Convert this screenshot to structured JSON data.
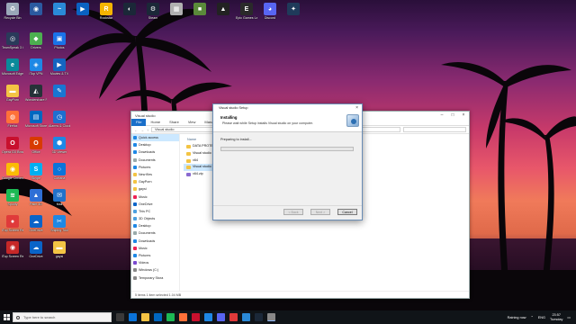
{
  "desktop": {
    "icons": [
      {
        "label": "Recycle Bin",
        "color": "#9aa8b8",
        "glyph": "♻"
      },
      {
        "label": "",
        "color": "#2b5aa0",
        "glyph": "◉"
      },
      {
        "label": "",
        "color": "#2a8ad8",
        "glyph": "~"
      },
      {
        "label": "",
        "color": "#0a62c2",
        "glyph": "▶"
      },
      {
        "label": "Rockstar",
        "color": "#f4b400",
        "glyph": "R"
      },
      {
        "label": "",
        "color": "#1b2838",
        "glyph": "◐"
      },
      {
        "label": "Steam",
        "color": "#1b2838",
        "glyph": "⚙"
      },
      {
        "label": "",
        "color": "#b0b0b0",
        "glyph": "▦"
      },
      {
        "label": "",
        "color": "#5a8a3a",
        "glyph": "■"
      },
      {
        "label": "",
        "color": "#222",
        "glyph": "▲"
      },
      {
        "label": "Epic Games Launcher",
        "color": "#2a2a2a",
        "glyph": "E"
      },
      {
        "label": "Discord",
        "color": "#5865f2",
        "glyph": "◕"
      },
      {
        "label": "",
        "color": "#1f3a5a",
        "glyph": "✦"
      },
      {
        "label": "TeamSpeak 3 Client",
        "color": "#2a3a5a",
        "glyph": "◎"
      },
      {
        "label": "Drivers",
        "color": "#4caf50",
        "glyph": "◆"
      },
      {
        "label": "Photos",
        "color": "#1a73e8",
        "glyph": "▣"
      },
      {
        "label": "Microsoft Edge",
        "color": "#0a8a9a",
        "glyph": "e"
      },
      {
        "label": "iTop VPN",
        "color": "#1e88e5",
        "glyph": "◈"
      },
      {
        "label": "Movies & TV",
        "color": "#1565c0",
        "glyph": "▶"
      },
      {
        "label": "GayPorn",
        "color": "#f3c444",
        "glyph": "▬"
      },
      {
        "label": "Wondershare Filmora 11",
        "color": "#263238",
        "glyph": "◭"
      },
      {
        "label": "",
        "color": "#1976d2",
        "glyph": "✎"
      },
      {
        "label": "Firefox",
        "color": "#ff7139",
        "glyph": "◍"
      },
      {
        "label": "Microsoft Store",
        "color": "#0067c0",
        "glyph": "▤"
      },
      {
        "label": "Alarms & Clock",
        "color": "#1e6fd0",
        "glyph": "◷"
      },
      {
        "label": "Opera GX Browser",
        "color": "#c8102e",
        "glyph": "O"
      },
      {
        "label": "Office",
        "color": "#d83b01",
        "glyph": "O"
      },
      {
        "label": "3D Viewer",
        "color": "#1e88e5",
        "glyph": "⬢"
      },
      {
        "label": "Google Chrome",
        "color": "#fbbc05",
        "glyph": "◉"
      },
      {
        "label": "Skype",
        "color": "#00aff0",
        "glyph": "S"
      },
      {
        "label": "Cortana",
        "color": "#0a74da",
        "glyph": "○"
      },
      {
        "label": "Spotify",
        "color": "#1db954",
        "glyph": "≋"
      },
      {
        "label": "Paint 3D",
        "color": "#2f6fd6",
        "glyph": "▲"
      },
      {
        "label": "Mail",
        "color": "#2272c9",
        "glyph": "✉"
      },
      {
        "label": "iTop Screen Recorder",
        "color": "#e03a3a",
        "glyph": "●"
      },
      {
        "label": "OneDrive",
        "color": "#0a64c8",
        "glyph": "☁"
      },
      {
        "label": "Sniping Tool",
        "color": "#1e88e5",
        "glyph": "✂"
      },
      {
        "label": "iTop Screen Recorder",
        "color": "#c62828",
        "glyph": "◉"
      },
      {
        "label": "OneDrive",
        "color": "#0a64c8",
        "glyph": "☁"
      },
      {
        "label": "gaysi",
        "color": "#f3c444",
        "glyph": "▬"
      }
    ]
  },
  "explorer": {
    "title": "Visual studio",
    "ribbon": {
      "file": "File",
      "tabs": [
        "Home",
        "Share",
        "View",
        "Manage"
      ]
    },
    "address": "Visual studio",
    "column_name": "Name",
    "nav_items": [
      {
        "label": "Quick access",
        "color": "#1e88e5",
        "sel": true
      },
      {
        "label": "Desktop",
        "color": "#1e88e5"
      },
      {
        "label": "Downloads",
        "color": "#1e88e5"
      },
      {
        "label": "Documents",
        "color": "#9aa"
      },
      {
        "label": "Pictures",
        "color": "#1e88e5"
      },
      {
        "label": "New files",
        "color": "#f3c444"
      },
      {
        "label": "GayPorn",
        "color": "#f3c444"
      },
      {
        "label": "gaysi",
        "color": "#f3c444"
      },
      {
        "label": "Music",
        "color": "#e25"
      },
      {
        "label": "OneDrive",
        "color": "#0a64c8"
      },
      {
        "label": "This PC",
        "color": "#4aa0e0"
      },
      {
        "label": "3D Objects",
        "color": "#4aa0e0"
      },
      {
        "label": "Desktop",
        "color": "#1e88e5"
      },
      {
        "label": "Documents",
        "color": "#9aa"
      },
      {
        "label": "Downloads",
        "color": "#1e88e5"
      },
      {
        "label": "Music",
        "color": "#e25"
      },
      {
        "label": "Pictures",
        "color": "#1e88e5"
      },
      {
        "label": "Videos",
        "color": "#7a4ad0"
      },
      {
        "label": "Windows (C:)",
        "color": "#888"
      },
      {
        "label": "Temporary Stora",
        "color": "#888"
      }
    ],
    "files": [
      {
        "name": "DATA PROTEC",
        "type": "folder"
      },
      {
        "name": "Visual studio",
        "type": "folder"
      },
      {
        "name": "x64",
        "type": "folder"
      },
      {
        "name": "Visual studio",
        "type": "folder",
        "sel": true
      },
      {
        "name": "x64.zip",
        "type": "zip"
      }
    ],
    "status": "5 items     1 item selected  1.04 MB"
  },
  "dialog": {
    "title": "Visual studio Setup",
    "heading": "Installing",
    "subheading": "Please wait while Setup installs Visual studio on your computer.",
    "status": "Preparing to install...",
    "progress": 0,
    "buttons": {
      "back": "< Back",
      "next": "Next >",
      "cancel": "Cancel"
    }
  },
  "taskbar": {
    "search_placeholder": "Type here to search",
    "weather": "Raining now",
    "language": "ENG",
    "time": "23:57",
    "day": "Tuesday",
    "pinned_colors": [
      "#3a3a3a",
      "#0a74da",
      "#f3c444",
      "#0067c0",
      "#1db954",
      "#ff7139",
      "#c8102e",
      "#1e88e5",
      "#5865f2",
      "#e03a3a",
      "#2a8ad8",
      "#1b2838",
      "#888"
    ]
  }
}
